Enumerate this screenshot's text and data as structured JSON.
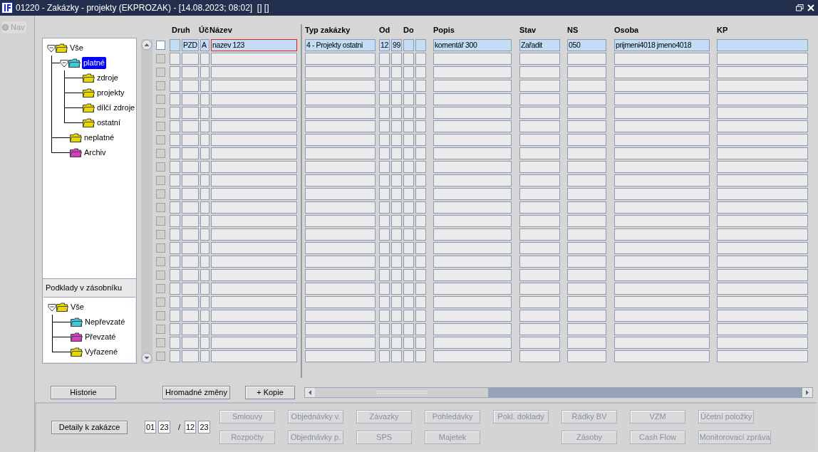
{
  "window": {
    "title": "01220 - Zakázky - projekty (EKPROZAK) - [14.08.2023; 08:02]  [] []"
  },
  "nav_option": {
    "label": "Nav",
    "disabled": true,
    "selected": false
  },
  "tree": [
    {
      "label": "Vše",
      "color": "#e8d800",
      "expanded": true,
      "selected": false,
      "children": [
        {
          "label": "platné",
          "color": "#40c8d8",
          "expanded": true,
          "selected": true,
          "children": [
            {
              "label": "zdroje",
              "color": "#e8d800",
              "selected": false
            },
            {
              "label": "projekty",
              "color": "#e8d800",
              "selected": false
            },
            {
              "label": "dílčí zdroje",
              "color": "#e8d800",
              "selected": false
            },
            {
              "label": "ostatní",
              "color": "#e8d800",
              "selected": false
            }
          ]
        },
        {
          "label": "neplatné",
          "color": "#e8d800",
          "selected": false
        },
        {
          "label": "Archiv",
          "color": "#d040c0",
          "selected": false
        }
      ]
    }
  ],
  "stack_panel": {
    "title": "Podklady v zásobníku",
    "tree": [
      {
        "label": "Vše",
        "color": "#e8d800",
        "expanded": true,
        "selected": false,
        "children": [
          {
            "label": "Nepřevzaté",
            "color": "#40c8d8",
            "selected": false
          },
          {
            "label": "Převzaté",
            "color": "#d040c0",
            "selected": false
          },
          {
            "label": "Vyřazené",
            "color": "#e8d800",
            "selected": false
          }
        ]
      }
    ]
  },
  "columns": [
    "Druh",
    "Úč",
    "Název",
    "Typ zakázky",
    "Od",
    "Do",
    "Popis",
    "Stav",
    "NS",
    "Osoba",
    "KP"
  ],
  "records": [
    {
      "current": true,
      "cells": {
        "druh": {
          "text": "PZD",
          "focused": false
        },
        "uc": {
          "text": "A",
          "focused": false
        },
        "nazev": {
          "text": "nazev 123",
          "focused": true
        },
        "typ": {
          "text": "4 - Projekty ostatni",
          "focused": false
        },
        "od_1": {
          "text": "12",
          "focused": false
        },
        "od_2": {
          "text": "99",
          "focused": false
        },
        "popis": {
          "text": "komentář 300",
          "focused": false
        },
        "stav": {
          "text": "Zařadit",
          "focused": false
        },
        "ns": {
          "text": "050",
          "focused": false
        },
        "osoba": {
          "text": "prijmeni4018 jmeno4018",
          "focused": false
        }
      }
    },
    {
      "current": false
    },
    {
      "current": false
    },
    {
      "current": false
    },
    {
      "current": false
    },
    {
      "current": false
    },
    {
      "current": false
    },
    {
      "current": false
    },
    {
      "current": false
    },
    {
      "current": false
    },
    {
      "current": false
    },
    {
      "current": false
    },
    {
      "current": false
    },
    {
      "current": false
    },
    {
      "current": false
    },
    {
      "current": false
    },
    {
      "current": false
    },
    {
      "current": false
    },
    {
      "current": false
    },
    {
      "current": false
    },
    {
      "current": false
    },
    {
      "current": false
    },
    {
      "current": false
    },
    {
      "current": false
    }
  ],
  "grid_buttons": [
    "Historie",
    "Hromadné změny",
    "+ Kopie"
  ],
  "detail_button": "Detaily k zakázce",
  "period": {
    "from_month": "01",
    "from_year": "23",
    "separator": "/",
    "to_month": "12",
    "to_year": "23"
  },
  "action_buttons": [
    {
      "kind": "button",
      "label": "Smlouvy",
      "disabled": true
    },
    {
      "kind": "button",
      "label": "Objednávky v.",
      "disabled": true
    },
    {
      "kind": "button",
      "label": "Závazky",
      "disabled": true
    },
    {
      "kind": "button",
      "label": "Pohledávky",
      "disabled": true
    },
    {
      "kind": "button",
      "label": "Pokl. doklady",
      "disabled": true
    },
    {
      "kind": "button",
      "label": "Řádky BV",
      "disabled": true
    },
    {
      "kind": "button",
      "label": "VZM",
      "disabled": true
    },
    {
      "kind": "button",
      "label": "Účetní položky",
      "disabled": true
    },
    {
      "kind": "button",
      "label": "Rozpočty",
      "disabled": true
    },
    {
      "kind": "button",
      "label": "Objednávky p.",
      "disabled": true
    },
    {
      "kind": "button",
      "label": "SPS",
      "disabled": true
    },
    {
      "kind": "button",
      "label": "Majetek",
      "disabled": true
    },
    {
      "kind": "spacer"
    },
    {
      "kind": "button",
      "label": "Zásoby",
      "disabled": true
    },
    {
      "kind": "button",
      "label": "Cash Flow",
      "disabled": true
    },
    {
      "kind": "button",
      "label": "Monitorovací zpráva",
      "disabled": true
    }
  ]
}
